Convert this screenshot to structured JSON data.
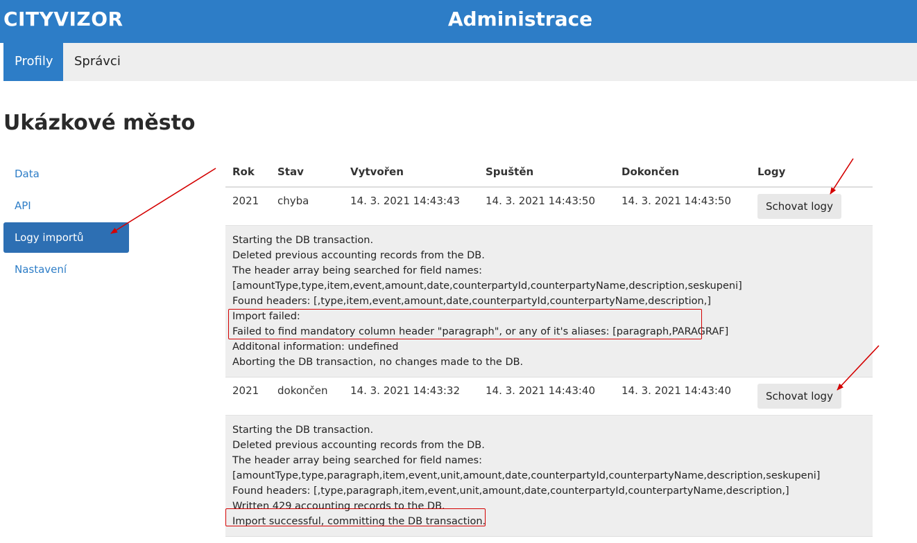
{
  "header": {
    "brand": "CITYVIZOR",
    "title": "Administrace"
  },
  "nav": {
    "tabs": [
      {
        "label": "Profily"
      },
      {
        "label": "Správci"
      }
    ]
  },
  "page": {
    "title": "Ukázkové město"
  },
  "sidebar": {
    "items": [
      {
        "label": "Data"
      },
      {
        "label": "API"
      },
      {
        "label": "Logy importů"
      },
      {
        "label": "Nastavení"
      }
    ]
  },
  "table": {
    "headers": {
      "year": "Rok",
      "status": "Stav",
      "created": "Vytvořen",
      "started": "Spuštěn",
      "finished": "Dokončen",
      "logs": "Logy"
    },
    "rows": [
      {
        "year": "2021",
        "status": "chyba",
        "created": "14. 3. 2021 14:43:43",
        "started": "14. 3. 2021 14:43:50",
        "finished": "14. 3. 2021 14:43:50",
        "button": "Schovat logy",
        "log": [
          "Starting the DB transaction.",
          "Deleted previous accounting records from the DB.",
          "The header array being searched for field names:",
          "[amountType,type,item,event,amount,date,counterpartyId,counterpartyName,description,seskupeni]",
          "Found headers: [,type,item,event,amount,date,counterpartyId,counterpartyName,description,]",
          "Import failed:",
          "Failed to find mandatory column header \"paragraph\", or any of it's aliases: [paragraph,PARAGRAF]",
          "Additonal information: undefined",
          "Aborting the DB transaction, no changes made to the DB."
        ]
      },
      {
        "year": "2021",
        "status": "dokončen",
        "created": "14. 3. 2021 14:43:32",
        "started": "14. 3. 2021 14:43:40",
        "finished": "14. 3. 2021 14:43:40",
        "button": "Schovat logy",
        "log": [
          "Starting the DB transaction.",
          "Deleted previous accounting records from the DB.",
          "The header array being searched for field names:",
          "[amountType,type,paragraph,item,event,unit,amount,date,counterpartyId,counterpartyName,description,seskupeni]",
          "Found headers: [,type,paragraph,item,event,unit,amount,date,counterpartyId,counterpartyName,description,]",
          "Written 429 accounting records to the DB.",
          "Import successful, committing the DB transaction."
        ]
      }
    ]
  },
  "annotations": {
    "color": "#d40000"
  }
}
